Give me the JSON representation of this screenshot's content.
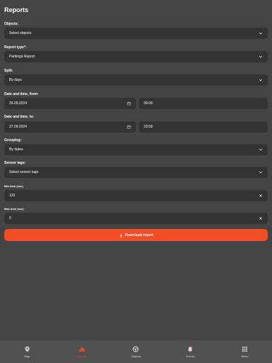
{
  "page": {
    "title": "Reports"
  },
  "form": {
    "objects_label": "Objects:",
    "objects_value": "Select objects",
    "report_type_label": "Report type*:",
    "report_type_value": "Parkings Report",
    "split_label": "Split:",
    "split_value": "By days",
    "from_label": "Date and time, from:",
    "from_date": "26.09.2024",
    "from_time": "00:00",
    "to_label": "Date and time, to:",
    "to_date": "27.09.2024",
    "to_time": "23:59",
    "grouping_label": "Grouping:",
    "grouping_value": "By dates",
    "sensor_tags_label": "Sensor tags:",
    "sensor_tags_value": "Select sensor tags",
    "min_time_label": "Min time (sec)",
    "min_time_value": "120",
    "max_time_label": "Max time (sec)",
    "max_time_value": "0",
    "download_label": "Download report"
  },
  "nav": {
    "items": [
      {
        "label": "Map",
        "icon": "map-pin-icon"
      },
      {
        "label": "Reports",
        "icon": "reports-icon"
      },
      {
        "label": "Objects",
        "icon": "steering-wheel-icon"
      },
      {
        "label": "Events",
        "icon": "bell-icon"
      },
      {
        "label": "Menu",
        "icon": "grid-icon"
      }
    ],
    "active": "Reports"
  },
  "colors": {
    "accent": "#f24d24",
    "background": "#444444",
    "field": "#333333",
    "nav": "#505050"
  }
}
